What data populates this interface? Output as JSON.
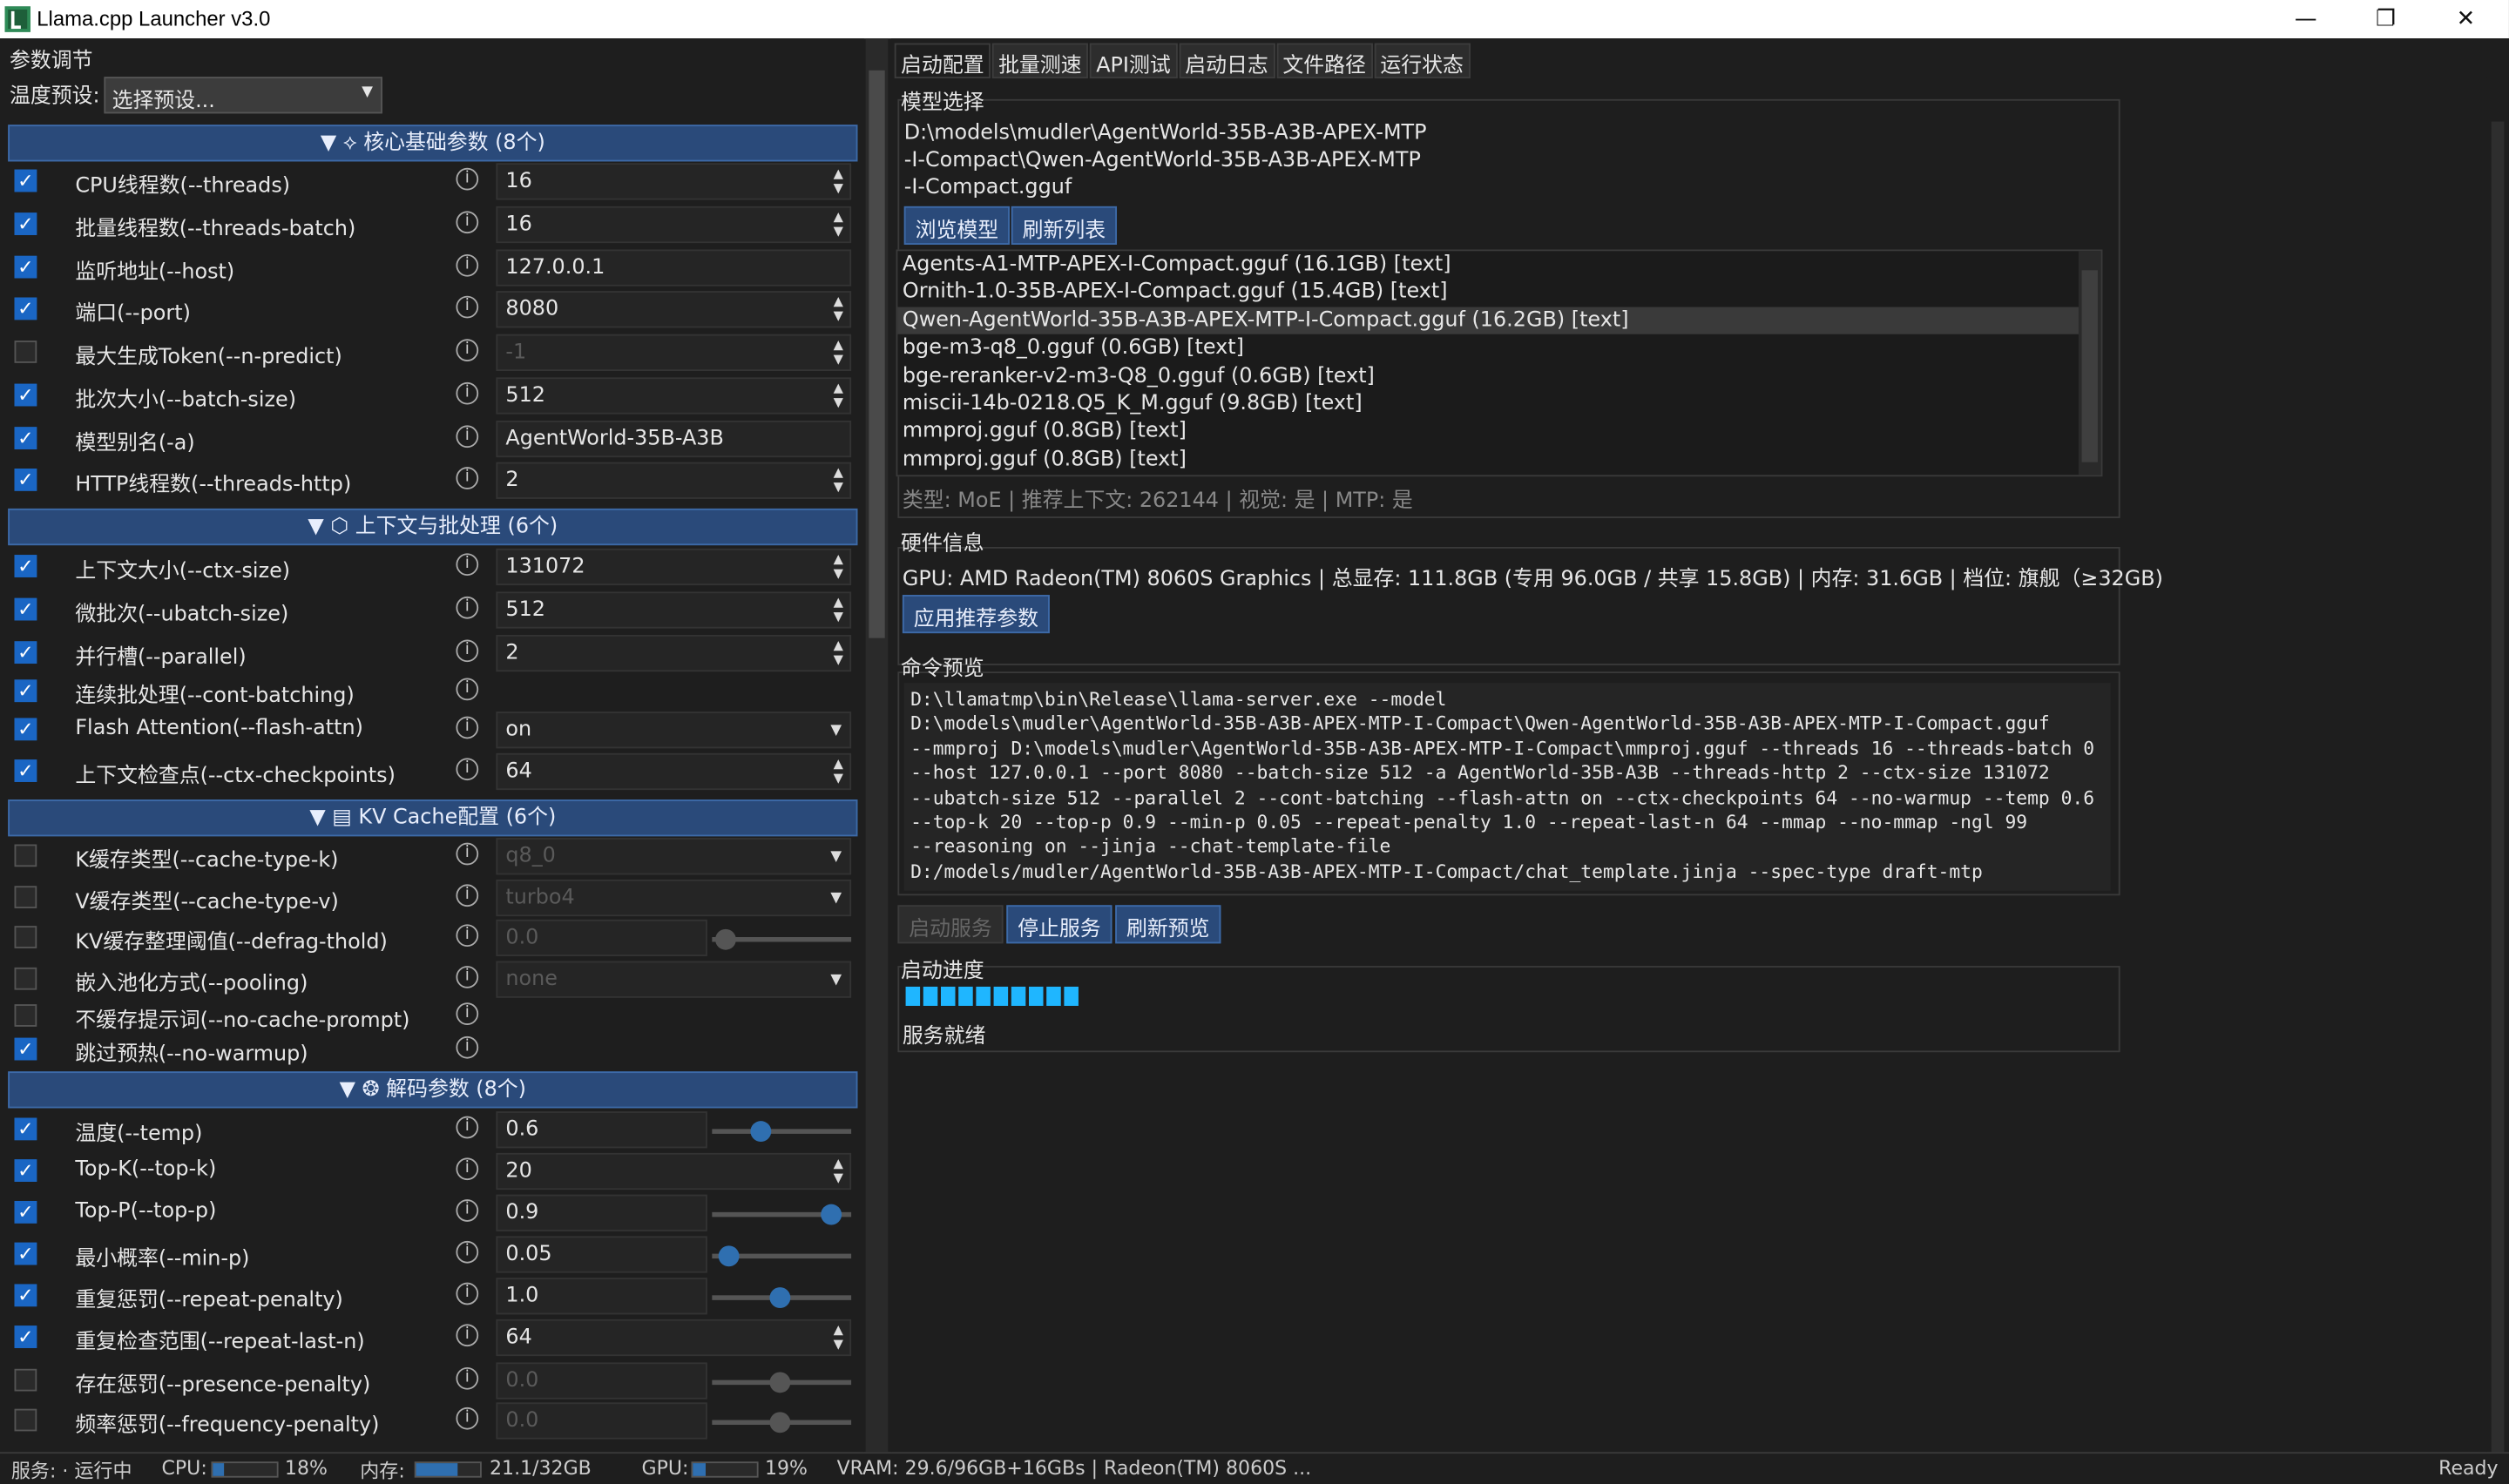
{
  "window": {
    "title": "Llama.cpp Launcher v3.0",
    "minimize": "—",
    "restore": "❐",
    "close": "✕"
  },
  "left": {
    "panel_title": "参数调节",
    "preset_label": "温度预设:",
    "preset_value": "选择预设...",
    "sections": [
      {
        "title": "▼ ⟡ 核心基础参数 (8个)"
      },
      {
        "title": "▼ ⬡ 上下文与批处理 (6个)"
      },
      {
        "title": "▼ ▤ KV Cache配置 (6个)"
      },
      {
        "title": "▼ ❂ 解码参数 (8个)"
      }
    ],
    "core": [
      {
        "label": "CPU线程数(--threads)",
        "value": "16",
        "checked": "✓"
      },
      {
        "label": "批量线程数(--threads-batch)",
        "value": "16",
        "checked": "✓"
      },
      {
        "label": "监听地址(--host)",
        "value": "127.0.0.1",
        "checked": "✓"
      },
      {
        "label": "端口(--port)",
        "value": "8080",
        "checked": "✓"
      },
      {
        "label": "最大生成Token(--n-predict)",
        "value": "-1",
        "checked": ""
      },
      {
        "label": "批次大小(--batch-size)",
        "value": "512",
        "checked": "✓"
      },
      {
        "label": "模型别名(-a)",
        "value": "AgentWorld-35B-A3B",
        "checked": "✓"
      },
      {
        "label": "HTTP线程数(--threads-http)",
        "value": "2",
        "checked": "✓"
      }
    ],
    "context": [
      {
        "label": "上下文大小(--ctx-size)",
        "value": "131072",
        "checked": "✓"
      },
      {
        "label": "微批次(--ubatch-size)",
        "value": "512",
        "checked": "✓"
      },
      {
        "label": "并行槽(--parallel)",
        "value": "2",
        "checked": "✓"
      },
      {
        "label": "连续批处理(--cont-batching)",
        "value": "",
        "checked": "✓"
      },
      {
        "label": "Flash Attention(--flash-attn)",
        "value": "on",
        "checked": "✓"
      },
      {
        "label": "上下文检查点(--ctx-checkpoints)",
        "value": "64",
        "checked": "✓"
      }
    ],
    "kv": [
      {
        "label": "K缓存类型(--cache-type-k)",
        "value": "q8_0",
        "checked": ""
      },
      {
        "label": "V缓存类型(--cache-type-v)",
        "value": "turbo4",
        "checked": ""
      },
      {
        "label": "KV缓存整理阈值(--defrag-thold)",
        "value": "0.0",
        "checked": ""
      },
      {
        "label": "嵌入池化方式(--pooling)",
        "value": "none",
        "checked": ""
      },
      {
        "label": "不缓存提示词(--no-cache-prompt)",
        "value": "",
        "checked": ""
      },
      {
        "label": "跳过预热(--no-warmup)",
        "value": "",
        "checked": "✓"
      }
    ],
    "decode": [
      {
        "label": "温度(--temp)",
        "value": "0.6",
        "checked": "✓"
      },
      {
        "label": "Top-K(--top-k)",
        "value": "20",
        "checked": "✓"
      },
      {
        "label": "Top-P(--top-p)",
        "value": "0.9",
        "checked": "✓"
      },
      {
        "label": "最小概率(--min-p)",
        "value": "0.05",
        "checked": "✓"
      },
      {
        "label": "重复惩罚(--repeat-penalty)",
        "value": "1.0",
        "checked": "✓"
      },
      {
        "label": "重复检查范围(--repeat-last-n)",
        "value": "64",
        "checked": "✓"
      },
      {
        "label": "存在惩罚(--presence-penalty)",
        "value": "0.0",
        "checked": ""
      },
      {
        "label": "频率惩罚(--frequency-penalty)",
        "value": "0.0",
        "checked": ""
      }
    ],
    "info_glyph": "i",
    "spin_glyph": "▲\n▼",
    "dd_glyph": "▼"
  },
  "tabs": [
    "启动配置",
    "批量测速",
    "API测试",
    "启动日志",
    "文件路径",
    "运行状态"
  ],
  "model": {
    "title": "模型选择",
    "path_lines": [
      "D:\\models\\mudler\\AgentWorld-35B-A3B-APEX-MTP",
      "-I-Compact\\Qwen-AgentWorld-35B-A3B-APEX-MTP",
      "-I-Compact.gguf"
    ],
    "browse": "浏览模型",
    "refresh": "刷新列表",
    "files": [
      "Agents-A1-MTP-APEX-I-Compact.gguf (16.1GB) [text]",
      "Ornith-1.0-35B-APEX-I-Compact.gguf (15.4GB) [text]",
      "Qwen-AgentWorld-35B-A3B-APEX-MTP-I-Compact.gguf (16.2GB) [text]",
      "bge-m3-q8_0.gguf (0.6GB) [text]",
      "bge-reranker-v2-m3-Q8_0.gguf (0.6GB) [text]",
      "miscii-14b-0218.Q5_K_M.gguf (9.8GB) [text]",
      "mmproj.gguf (0.8GB) [text]",
      "mmproj.gguf (0.8GB) [text]"
    ],
    "meta": "类型: MoE | 推荐上下文: 262144 | 视觉: 是 | MTP: 是"
  },
  "hardware": {
    "title": "硬件信息",
    "info": "GPU: AMD Radeon(TM) 8060S Graphics | 总显存: 111.8GB (专用 96.0GB / 共享 15.8GB) | 内存: 31.6GB | 档位: 旗舰（≥32GB)",
    "apply": "应用推荐参数"
  },
  "command": {
    "title": "命令预览",
    "text": "D:\\llamatmp\\bin\\Release\\llama-server.exe --model\nD:\\models\\mudler\\AgentWorld-35B-A3B-APEX-MTP-I-Compact\\Qwen-AgentWorld-35B-A3B-APEX-MTP-I-Compact.gguf\n--mmproj D:\\models\\mudler\\AgentWorld-35B-A3B-APEX-MTP-I-Compact\\mmproj.gguf --threads 16 --threads-batch 0\n--host 127.0.0.1 --port 8080 --batch-size 512 -a AgentWorld-35B-A3B --threads-http 2 --ctx-size 131072\n--ubatch-size 512 --parallel 2 --cont-batching --flash-attn on --ctx-checkpoints 64 --no-warmup --temp 0.6\n--top-k 20 --top-p 0.9 --min-p 0.05 --repeat-penalty 1.0 --repeat-last-n 64 --mmap --no-mmap -ngl 99\n--reasoning on --jinja --chat-template-file\nD:/models/mudler/AgentWorld-35B-A3B-APEX-MTP-I-Compact/chat_template.jinja --spec-type draft-mtp",
    "start": "启动服务",
    "stop": "停止服务",
    "refresh": "刷新预览"
  },
  "progress": {
    "title": "启动进度",
    "status": "服务就绪",
    "level": 1.0
  },
  "statusbar": {
    "service": "服务: · 运行中",
    "cpu_label": "CPU:",
    "cpu": "18%",
    "cpu_level": 0.18,
    "mem_label": "内存:",
    "mem": "21.1/32GB",
    "mem_level": 0.66,
    "gpu_label": "GPU:",
    "gpu": "19%",
    "gpu_level": 0.19,
    "vram": "VRAM: 29.6/96GB+16GBs  |  Radeon(TM) 8060S ...",
    "ready": "Ready"
  },
  "accent": "#2a4a7a",
  "progress_color": "#1fb6ff"
}
